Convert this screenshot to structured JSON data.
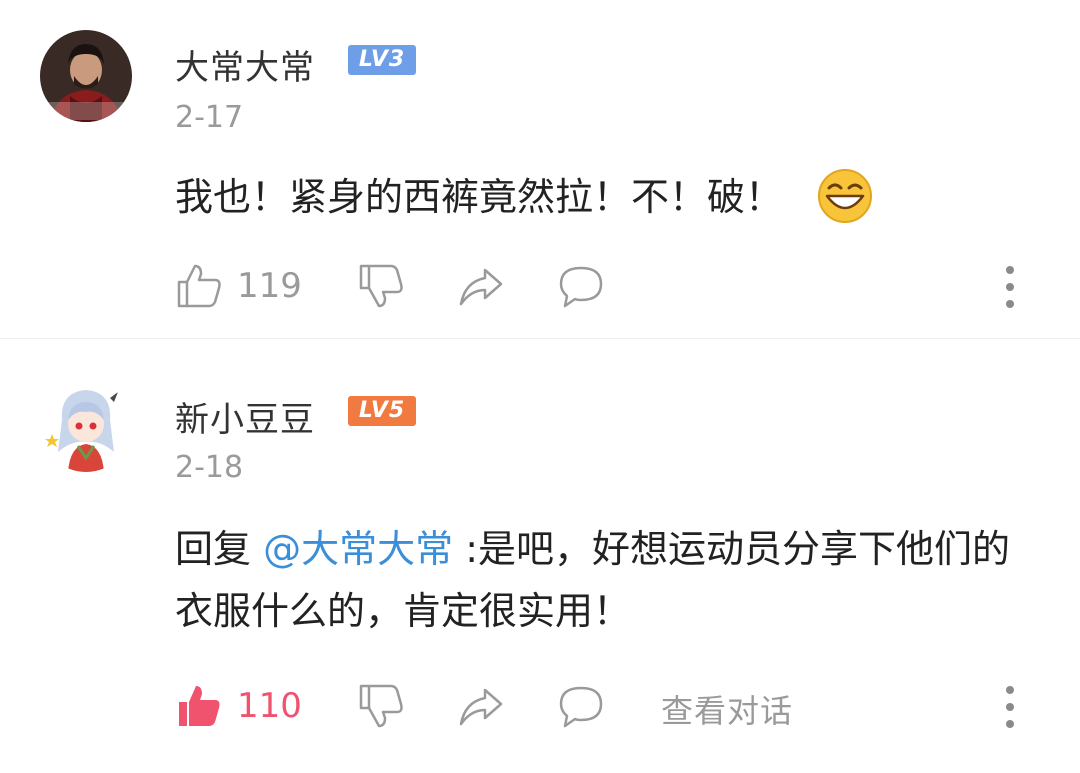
{
  "comments": [
    {
      "username": "大常大常",
      "level": "LV3",
      "date": "2-17",
      "text": "我也！紧身的西裤竟然拉！不！破！",
      "emoji": "grinning-face-icon",
      "likes": "119",
      "liked": false
    },
    {
      "username": "新小豆豆",
      "level": "LV5",
      "date": "2-18",
      "reply_prefix": "回复 ",
      "mention": "@大常大常",
      "text": " :是吧，好想运动员分享下他们的衣服什么的，肯定很实用！",
      "likes": "110",
      "liked": true,
      "view_thread": "查看对话"
    }
  ],
  "colors": {
    "level3": "#6f9ee8",
    "level5": "#f07a3f",
    "mention": "#3a8fd8",
    "liked": "#f0536e",
    "muted": "#9a9a9a"
  }
}
